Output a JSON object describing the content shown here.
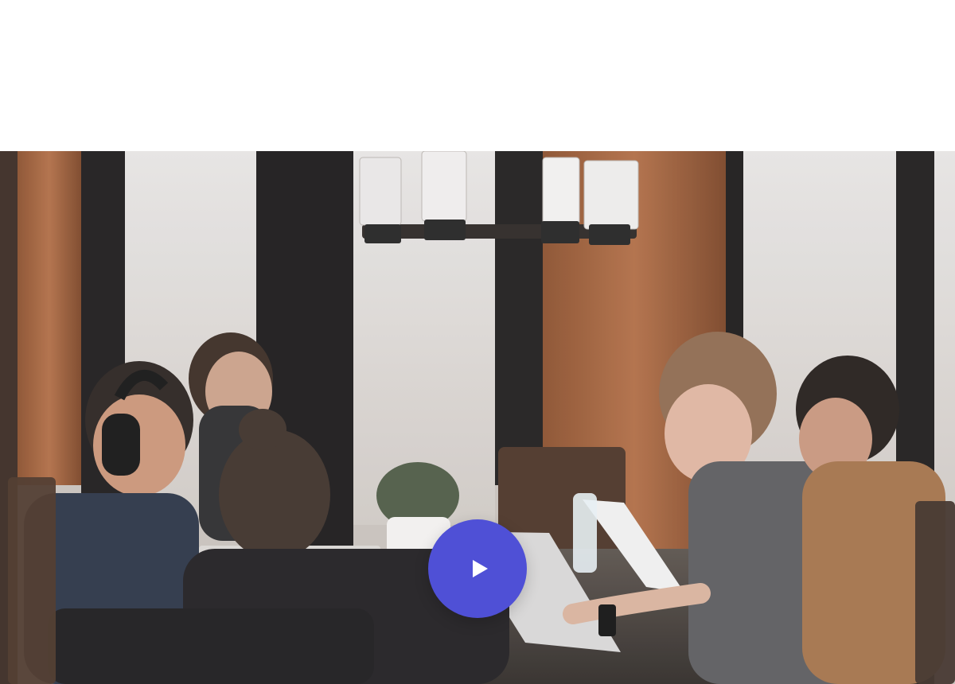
{
  "video": {
    "play_button_label": "Play video",
    "play_icon": "play-icon",
    "accent_color": "#4f50d6"
  }
}
